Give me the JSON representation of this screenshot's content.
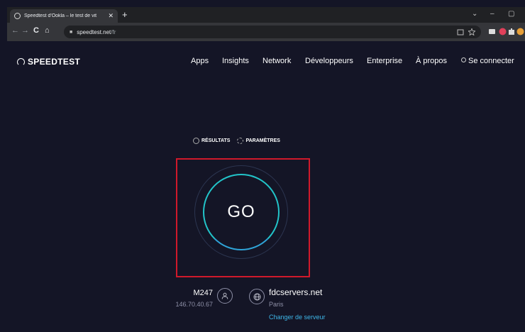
{
  "browser": {
    "tab_title": "Speedtest d'Ookla – le test de vit",
    "tab_close": "✕",
    "new_tab": "+",
    "url_host": "speedtest.net",
    "url_path": "/fr",
    "nav_back": "←",
    "nav_forward": "→",
    "reload": "C",
    "home": "⌂",
    "window_controls": [
      "⌄",
      "–",
      "▢"
    ]
  },
  "header": {
    "brand": "SPEEDTEST",
    "nav": [
      "Apps",
      "Insights",
      "Network",
      "Développeurs",
      "Enterprise",
      "À propos"
    ],
    "signin": "Se connecter"
  },
  "options": {
    "results": "RÉSULTATS",
    "settings": "PARAMÈTRES"
  },
  "go": {
    "label": "GO"
  },
  "isp": {
    "name": "M247",
    "ip": "146.70.40.67"
  },
  "server": {
    "name": "fdcservers.net",
    "city": "Paris",
    "change": "Changer de serveur"
  },
  "colors": {
    "background": "#141526",
    "go_ring": "#22c4c9",
    "link": "#3eb6e8",
    "highlight_box": "#d0192b"
  }
}
